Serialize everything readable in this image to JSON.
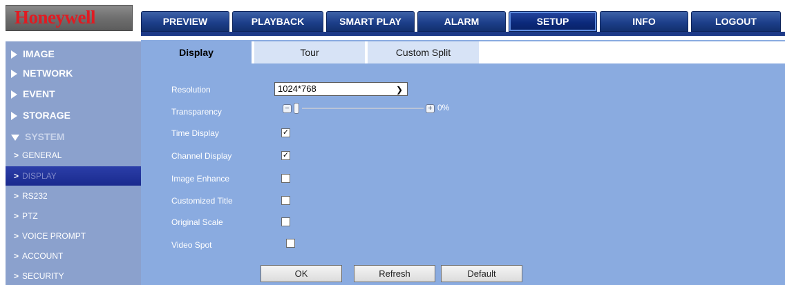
{
  "brand": {
    "logo_text": "Honeywell"
  },
  "nav": {
    "tabs": [
      {
        "label": "PREVIEW"
      },
      {
        "label": "PLAYBACK"
      },
      {
        "label": "SMART PLAY"
      },
      {
        "label": "ALARM"
      },
      {
        "label": "SETUP"
      },
      {
        "label": "INFO"
      },
      {
        "label": "LOGOUT"
      }
    ],
    "active": "SETUP"
  },
  "sidebar": {
    "sections": [
      {
        "label": "IMAGE"
      },
      {
        "label": "NETWORK"
      },
      {
        "label": "EVENT"
      },
      {
        "label": "STORAGE"
      },
      {
        "label": "SYSTEM"
      }
    ],
    "system_items": [
      {
        "label": "GENERAL"
      },
      {
        "label": "DISPLAY"
      },
      {
        "label": "RS232"
      },
      {
        "label": "PTZ"
      },
      {
        "label": "VOICE PROMPT"
      },
      {
        "label": "ACCOUNT"
      },
      {
        "label": "SECURITY"
      }
    ],
    "chevron": ">",
    "active_item": "DISPLAY"
  },
  "subtabs": [
    {
      "label": "Display"
    },
    {
      "label": "Tour"
    },
    {
      "label": "Custom Split"
    }
  ],
  "form": {
    "resolution": {
      "label": "Resolution",
      "value": "1024*768"
    },
    "transparency": {
      "label": "Transparency",
      "value_text": "0%",
      "value": 0,
      "minus": "−",
      "plus": "+"
    },
    "checkboxes": [
      {
        "label": "Time Display",
        "checked": true
      },
      {
        "label": "Channel Display",
        "checked": true
      },
      {
        "label": "Image Enhance",
        "checked": false
      },
      {
        "label": "Customized Title",
        "checked": false
      },
      {
        "label": "Original Scale",
        "checked": false
      },
      {
        "label": "Video Spot",
        "checked": false
      }
    ],
    "check_mark": "✓"
  },
  "buttons": {
    "ok": "OK",
    "refresh": "Refresh",
    "default": "Default"
  },
  "colors": {
    "brand_red": "#e01b22",
    "nav_blue": "#1d3f8a",
    "panel_blue": "#8aabe0",
    "sidebar_blue": "#8ba1cd"
  }
}
